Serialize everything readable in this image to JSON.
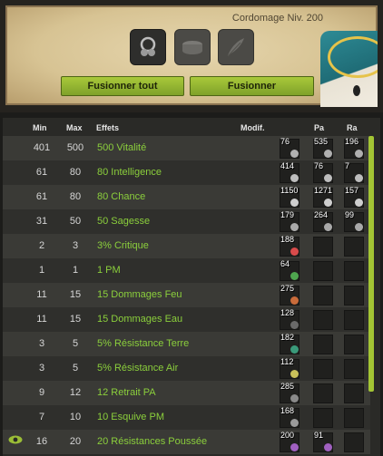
{
  "header": {
    "craft_title": "Cordomage Niv. 200",
    "buttons": {
      "fusion_all": "Fusionner tout",
      "fusion": "Fusionner"
    }
  },
  "table": {
    "columns": {
      "min": "Min",
      "max": "Max",
      "effects": "Effets",
      "modif": "Modif.",
      "pa": "Pa",
      "ra": "Ra"
    },
    "rows": [
      {
        "min": "401",
        "max": "500",
        "effect": "500 Vitalité",
        "modif": "76",
        "pa": "535",
        "ra": "196"
      },
      {
        "min": "61",
        "max": "80",
        "effect": "80 Intelligence",
        "modif": "414",
        "pa": "76",
        "ra": "7"
      },
      {
        "min": "61",
        "max": "80",
        "effect": "80 Chance",
        "modif": "1150",
        "pa": "1271",
        "ra": "157"
      },
      {
        "min": "31",
        "max": "50",
        "effect": "50 Sagesse",
        "modif": "179",
        "pa": "264",
        "ra": "99"
      },
      {
        "min": "2",
        "max": "3",
        "effect": "3% Critique",
        "modif": "188",
        "pa": "",
        "ra": ""
      },
      {
        "min": "1",
        "max": "1",
        "effect": "1 PM",
        "modif": "64",
        "pa": "",
        "ra": ""
      },
      {
        "min": "11",
        "max": "15",
        "effect": "15 Dommages Feu",
        "modif": "275",
        "pa": "",
        "ra": ""
      },
      {
        "min": "11",
        "max": "15",
        "effect": "15 Dommages Eau",
        "modif": "128",
        "pa": "",
        "ra": ""
      },
      {
        "min": "3",
        "max": "5",
        "effect": "5% Résistance Terre",
        "modif": "182",
        "pa": "",
        "ra": ""
      },
      {
        "min": "3",
        "max": "5",
        "effect": "5% Résistance Air",
        "modif": "112",
        "pa": "",
        "ra": ""
      },
      {
        "min": "9",
        "max": "12",
        "effect": "12 Retrait PA",
        "modif": "285",
        "pa": "",
        "ra": ""
      },
      {
        "min": "7",
        "max": "10",
        "effect": "10 Esquive PM",
        "modif": "168",
        "pa": "",
        "ra": ""
      },
      {
        "min": "16",
        "max": "20",
        "effect": "20 Résistances Poussée",
        "modif": "200",
        "pa": "91",
        "ra": ""
      }
    ]
  },
  "colors": {
    "effect_green": "#8bcf3c",
    "button_green": "#9bbd36",
    "scrollbar": "#a3c534"
  }
}
